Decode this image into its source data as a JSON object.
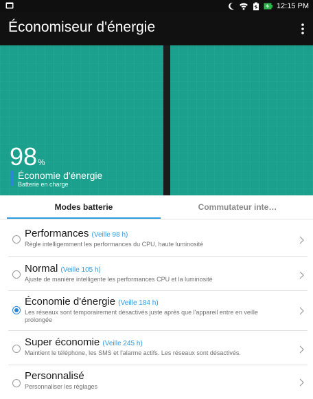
{
  "status_bar": {
    "time": "12:15 PM",
    "icons": [
      "notification-icon",
      "moon-icon",
      "wifi-icon",
      "battery-saver-icon",
      "battery-charging-icon"
    ]
  },
  "app_bar": {
    "title": "Économiseur d'énergie",
    "menu_icon": "more-vert-icon"
  },
  "hero": {
    "battery_percent": "98",
    "percent_unit": "%",
    "current_mode": "Économie d'énergie",
    "charging_status": "Batterie en charge"
  },
  "tabs": [
    {
      "label": "Modes batterie",
      "selected": true
    },
    {
      "label": "Commutateur inte…",
      "selected": false
    }
  ],
  "modes": [
    {
      "title": "Performances",
      "standby": "(Veille 98  h)",
      "description": "Règle intelligemment les performances du CPU, haute luminosité",
      "selected": false
    },
    {
      "title": "Normal",
      "standby": "(Veille 105  h)",
      "description": "Ajuste de manière intelligente les performances CPU et la luminosité",
      "selected": false
    },
    {
      "title": "Économie d'énergie",
      "standby": "(Veille 184  h)",
      "description": "Les réseaux sont temporairement désactivés juste après que l'appareil entre en veille prolongée",
      "selected": true
    },
    {
      "title": "Super économie",
      "standby": "(Veille 245  h)",
      "description": "Maintient le téléphone, les SMS et l'alarme actifs. Les réseaux sont désactivés.",
      "selected": false
    },
    {
      "title": "Personnalisé",
      "standby": "",
      "description": "Personnaliser les réglages",
      "selected": false
    }
  ],
  "colors": {
    "hero_teal": "#1aa08c",
    "accent_blue": "#2e9be0",
    "app_bar": "#111111"
  }
}
